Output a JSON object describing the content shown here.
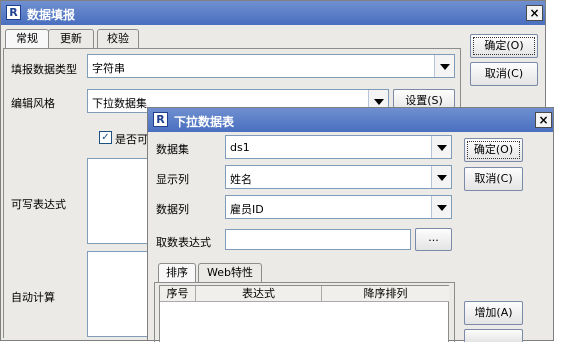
{
  "main_dialog": {
    "title": "数据填报",
    "close_glyph": "×",
    "tabs": [
      {
        "label": "常规",
        "active": true
      },
      {
        "label": "更新",
        "active": false
      },
      {
        "label": "校验",
        "active": false
      }
    ],
    "fields": {
      "data_type_label": "填报数据类型",
      "data_type_value": "字符串",
      "edit_style_label": "编辑风格",
      "edit_style_value": "下拉数据集",
      "settings_button": "设置(S)",
      "checkbox_label": "是否可",
      "writable_expr_label": "可写表达式",
      "auto_calc_label": "自动计算"
    },
    "buttons": {
      "ok": "确定(O)",
      "cancel": "取消(C)"
    }
  },
  "sub_dialog": {
    "title": "下拉数据表",
    "close_glyph": "×",
    "fields": {
      "dataset_label": "数据集",
      "dataset_value": "ds1",
      "display_col_label": "显示列",
      "display_col_value": "姓名",
      "data_col_label": "数据列",
      "data_col_value": "雇员ID",
      "fetch_expr_label": "取数表达式",
      "fetch_expr_value": "",
      "browse_button": "..."
    },
    "tabs": [
      {
        "label": "排序",
        "active": true
      },
      {
        "label": "Web特性",
        "active": false
      }
    ],
    "table": {
      "headers": [
        "序号",
        "表达式",
        "降序排列"
      ]
    },
    "buttons": {
      "ok": "确定(O)",
      "cancel": "取消(C)",
      "add": "增加(A)"
    }
  },
  "colors": {
    "title_bar": "#4a6fbf",
    "window_bg": "#eceae6",
    "field_border": "#7f9db9"
  },
  "icons": {
    "app": "app-logo-icon",
    "close": "close-icon",
    "dropdown": "chevron-down-icon",
    "check": "checkmark-icon"
  }
}
